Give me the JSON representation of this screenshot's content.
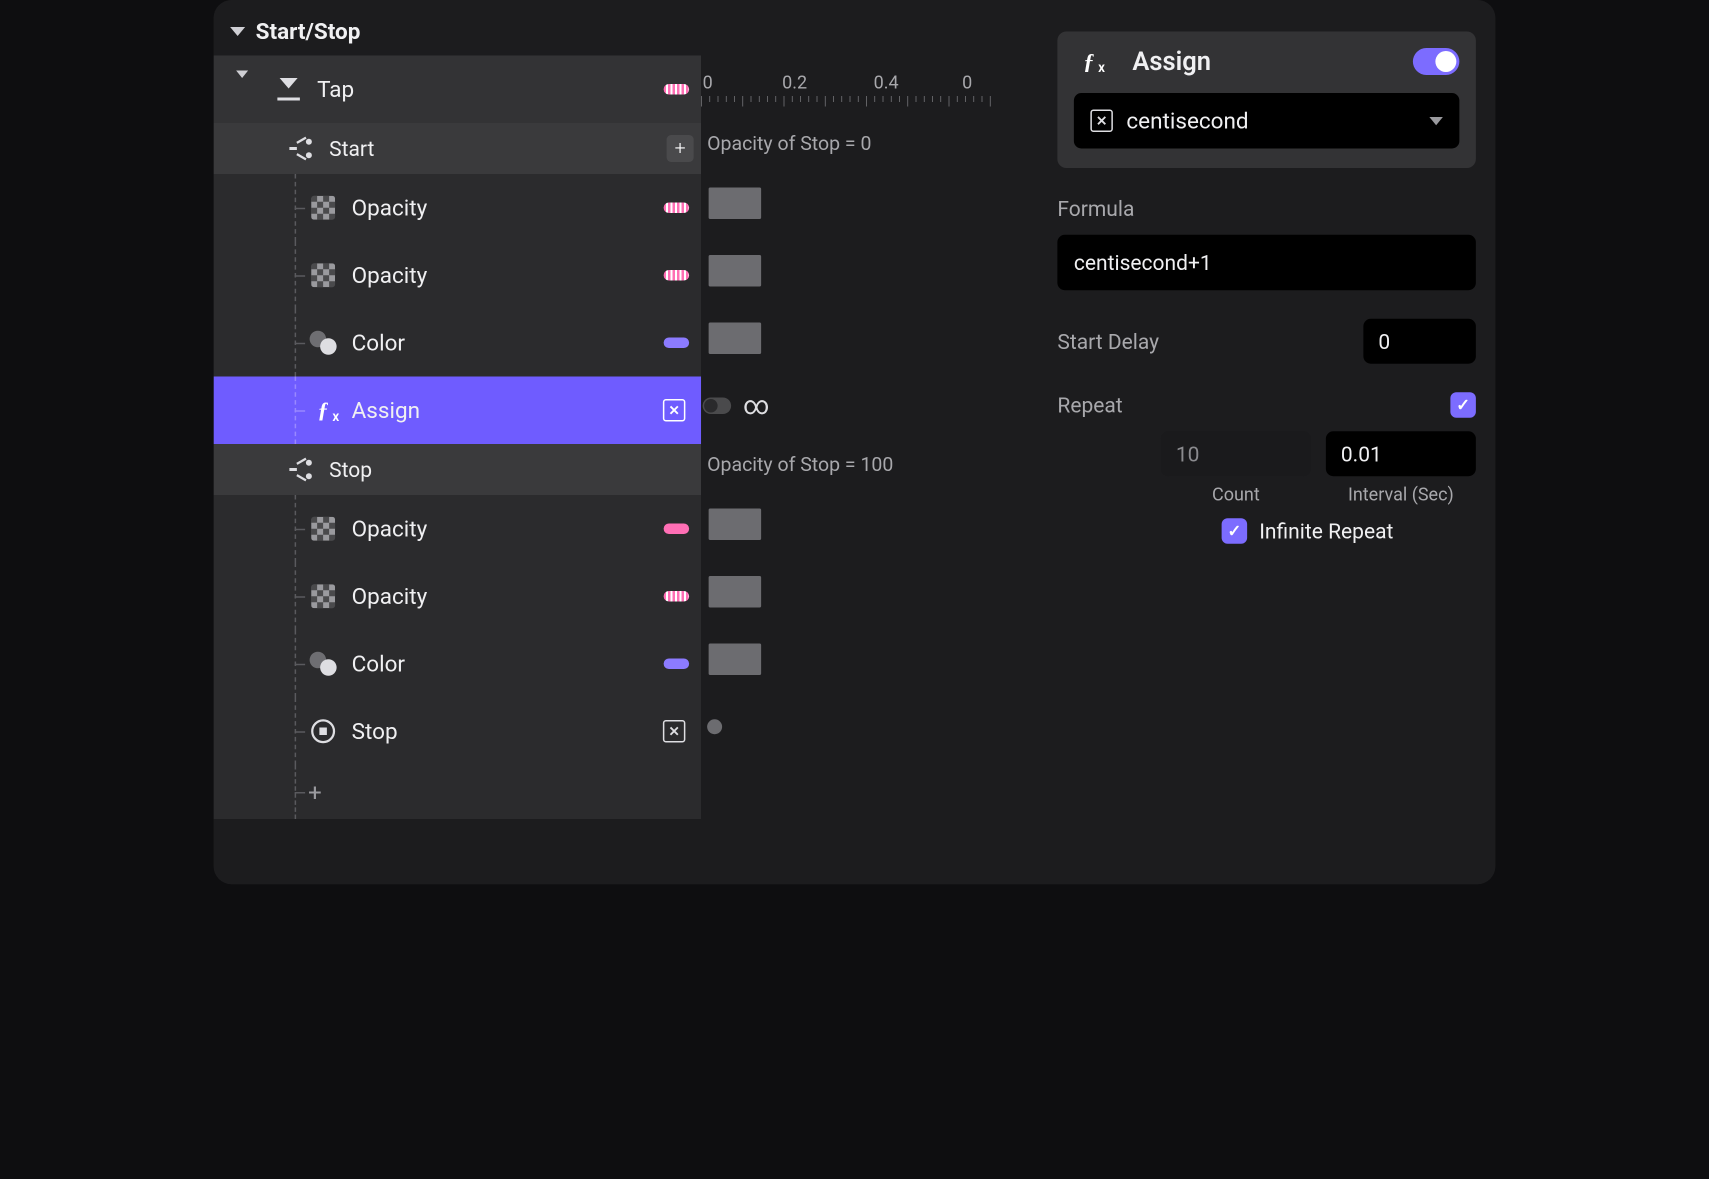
{
  "colors": {
    "accent": "#7c6cff"
  },
  "header": "Start/Stop",
  "tap": {
    "label": "Tap"
  },
  "start": {
    "header": "Start",
    "items": [
      {
        "label": "Opacity",
        "swatch": "pinkdot"
      },
      {
        "label": "Opacity",
        "swatch": "pinkdot"
      },
      {
        "label": "Color",
        "swatch": "purple"
      },
      {
        "label": "Assign",
        "xbox": true,
        "selected": true
      }
    ]
  },
  "stop": {
    "header": "Stop",
    "items": [
      {
        "label": "Opacity",
        "swatch": "pink"
      },
      {
        "label": "Opacity",
        "swatch": "pinkdot"
      },
      {
        "label": "Color",
        "swatch": "purple"
      },
      {
        "label": "Stop",
        "xbox": true
      }
    ]
  },
  "timeline": {
    "ticks": [
      "0",
      "0.2",
      "0.4",
      "0"
    ],
    "startText": "Opacity of Stop = 0",
    "stopText": "Opacity of Stop = 100",
    "infinity": "∞"
  },
  "props": {
    "assign": {
      "title": "Assign",
      "variable": "centisecond",
      "toggle": true
    },
    "formula": {
      "label": "Formula",
      "value": "centisecond+1"
    },
    "startDelay": {
      "label": "Start Delay",
      "value": "0"
    },
    "repeat": {
      "label": "Repeat",
      "enabled": true,
      "count": "10",
      "interval": "0.01",
      "countLabel": "Count",
      "intervalLabel": "Interval (Sec)",
      "infinite": "Infinite Repeat",
      "infiniteOn": true
    }
  }
}
